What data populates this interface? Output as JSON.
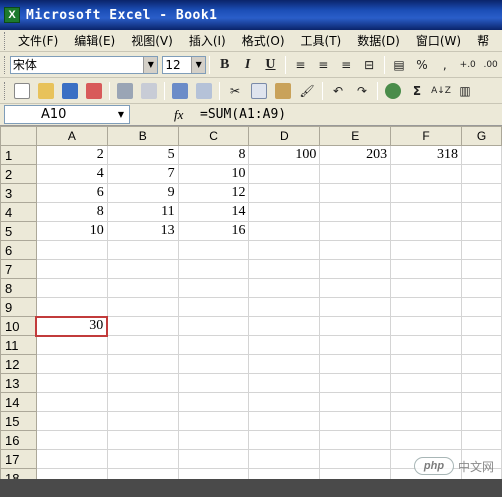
{
  "window": {
    "title": "Microsoft Excel - Book1",
    "app_icon_letter": "X"
  },
  "menu": [
    "文件(F)",
    "编辑(E)",
    "视图(V)",
    "插入(I)",
    "格式(O)",
    "工具(T)",
    "数据(D)",
    "窗口(W)",
    "帮"
  ],
  "format_toolbar": {
    "font_name": "宋体",
    "font_size": "12",
    "bold": "B",
    "italic": "I",
    "underline": "U",
    "percent": "%",
    "comma": ",",
    "inc_decimal": "+.0",
    "dec_decimal": ".00"
  },
  "standard_toolbar": {
    "sum_glyph": "Σ",
    "sort": "A↓Z"
  },
  "formula_bar": {
    "name_box": "A10",
    "fx": "fx",
    "formula": "=SUM(A1:A9)"
  },
  "sheet": {
    "columns": [
      "A",
      "B",
      "C",
      "D",
      "E",
      "F",
      "G"
    ],
    "rows": [
      {
        "num": "1",
        "cells": [
          "2",
          "5",
          "8",
          "100",
          "203",
          "318",
          ""
        ]
      },
      {
        "num": "2",
        "cells": [
          "4",
          "7",
          "10",
          "",
          "",
          "",
          ""
        ]
      },
      {
        "num": "3",
        "cells": [
          "6",
          "9",
          "12",
          "",
          "",
          "",
          ""
        ]
      },
      {
        "num": "4",
        "cells": [
          "8",
          "11",
          "14",
          "",
          "",
          "",
          ""
        ]
      },
      {
        "num": "5",
        "cells": [
          "10",
          "13",
          "16",
          "",
          "",
          "",
          ""
        ]
      },
      {
        "num": "6",
        "cells": [
          "",
          "",
          "",
          "",
          "",
          "",
          ""
        ]
      },
      {
        "num": "7",
        "cells": [
          "",
          "",
          "",
          "",
          "",
          "",
          ""
        ]
      },
      {
        "num": "8",
        "cells": [
          "",
          "",
          "",
          "",
          "",
          "",
          ""
        ]
      },
      {
        "num": "9",
        "cells": [
          "",
          "",
          "",
          "",
          "",
          "",
          ""
        ]
      },
      {
        "num": "10",
        "cells": [
          "30",
          "",
          "",
          "",
          "",
          "",
          ""
        ]
      },
      {
        "num": "11",
        "cells": [
          "",
          "",
          "",
          "",
          "",
          "",
          ""
        ]
      },
      {
        "num": "12",
        "cells": [
          "",
          "",
          "",
          "",
          "",
          "",
          ""
        ]
      },
      {
        "num": "13",
        "cells": [
          "",
          "",
          "",
          "",
          "",
          "",
          ""
        ]
      },
      {
        "num": "14",
        "cells": [
          "",
          "",
          "",
          "",
          "",
          "",
          ""
        ]
      },
      {
        "num": "15",
        "cells": [
          "",
          "",
          "",
          "",
          "",
          "",
          ""
        ]
      },
      {
        "num": "16",
        "cells": [
          "",
          "",
          "",
          "",
          "",
          "",
          ""
        ]
      },
      {
        "num": "17",
        "cells": [
          "",
          "",
          "",
          "",
          "",
          "",
          ""
        ]
      },
      {
        "num": "18",
        "cells": [
          "",
          "",
          "",
          "",
          "",
          "",
          ""
        ]
      }
    ],
    "active_cell": "A10"
  },
  "watermark": {
    "logo": "php",
    "text": "中文网"
  }
}
